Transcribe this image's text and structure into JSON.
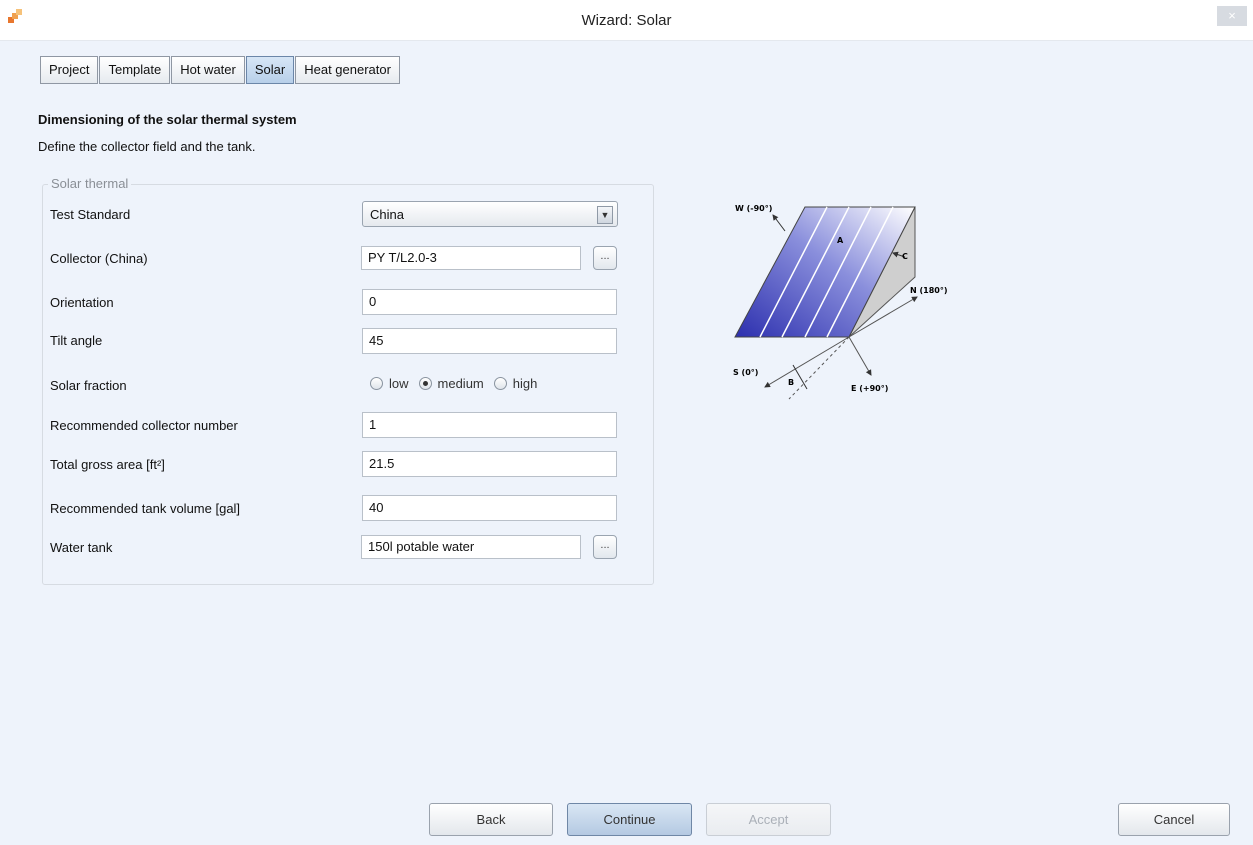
{
  "window": {
    "title": "Wizard: Solar",
    "close_glyph": "×"
  },
  "tabs": [
    {
      "label": "Project"
    },
    {
      "label": "Template"
    },
    {
      "label": "Hot water"
    },
    {
      "label": "Solar",
      "active": true
    },
    {
      "label": "Heat generator"
    }
  ],
  "heading": "Dimensioning of the solar thermal system",
  "description": "Define the collector field and the tank.",
  "group_title": "Solar thermal",
  "fields": {
    "test_standard": {
      "label": "Test Standard",
      "value": "China"
    },
    "collector": {
      "label": "Collector (China)",
      "value": "PY T/L2.0-3",
      "browse": "..."
    },
    "orientation": {
      "label": "Orientation",
      "value": "0"
    },
    "tilt_angle": {
      "label": "Tilt angle",
      "value": "45"
    },
    "solar_fraction": {
      "label": "Solar fraction",
      "options": [
        "low",
        "medium",
        "high"
      ],
      "selected": "medium"
    },
    "collector_number": {
      "label": "Recommended collector number",
      "value": "1"
    },
    "gross_area": {
      "label": "Total gross area [ft²]",
      "value": "21.5"
    },
    "tank_volume": {
      "label": "Recommended tank volume  [gal]",
      "value": "40"
    },
    "water_tank": {
      "label": "Water tank",
      "value": "150l potable water",
      "browse": "..."
    }
  },
  "diagram": {
    "labels": {
      "w": "W (-90°)",
      "n": "N (180°)",
      "s": "S (0°)",
      "e": "E (+90°)",
      "a": "A",
      "b": "B",
      "c": "C"
    }
  },
  "buttons": {
    "back": "Back",
    "continue": "Continue",
    "accept": "Accept",
    "cancel": "Cancel"
  },
  "colors": {
    "accent": "#b4c9e2",
    "collector_blue": "#3a3fb8",
    "background": "#eef3fb"
  }
}
